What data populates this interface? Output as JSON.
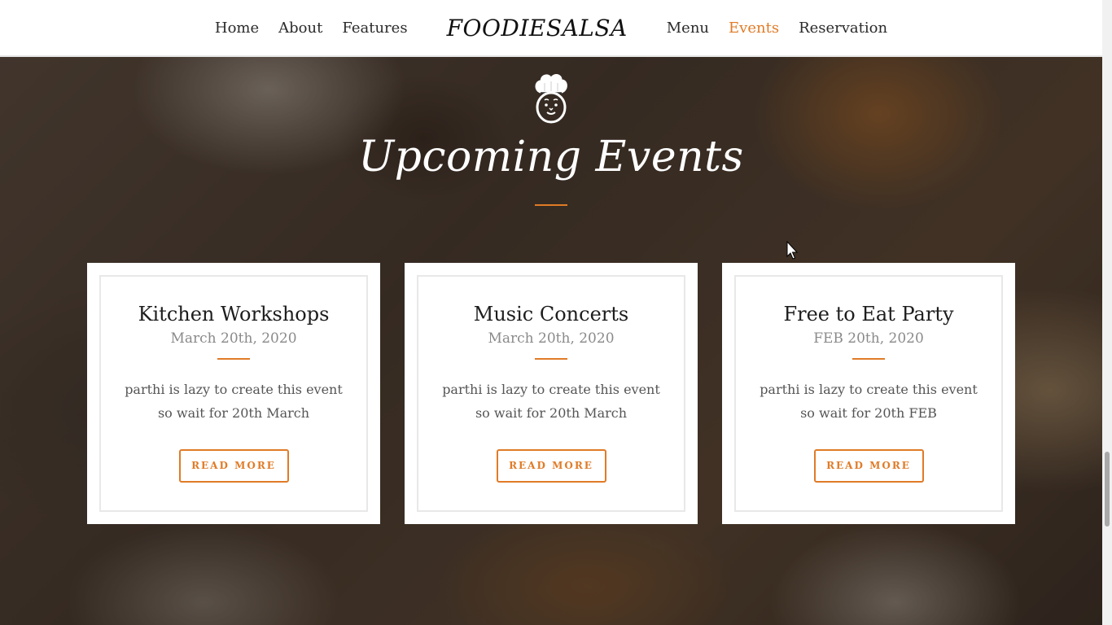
{
  "nav": {
    "left_links": [
      "Home",
      "About",
      "Features"
    ],
    "brand": "FOODIESALSA",
    "right_links": [
      "Menu",
      "Events",
      "Reservation"
    ],
    "active": "Events"
  },
  "section": {
    "icon": "chef-icon",
    "title": "Upcoming Events"
  },
  "events": [
    {
      "title": "Kitchen Workshops",
      "date": "March 20th, 2020",
      "text": "parthi is lazy to create this event so wait for 20th March",
      "button": "READ MORE"
    },
    {
      "title": "Music Concerts",
      "date": "March 20th, 2020",
      "text": "parthi is lazy to create this event so wait for 20th March",
      "button": "READ MORE"
    },
    {
      "title": "Free to Eat Party",
      "date": "FEB 20th, 2020",
      "text": "parthi is lazy to create this event so wait for 20th FEB",
      "button": "READ MORE"
    }
  ],
  "colors": {
    "accent": "#e07b27",
    "nav_text": "#2a2a2a",
    "card_bg": "#ffffff"
  }
}
